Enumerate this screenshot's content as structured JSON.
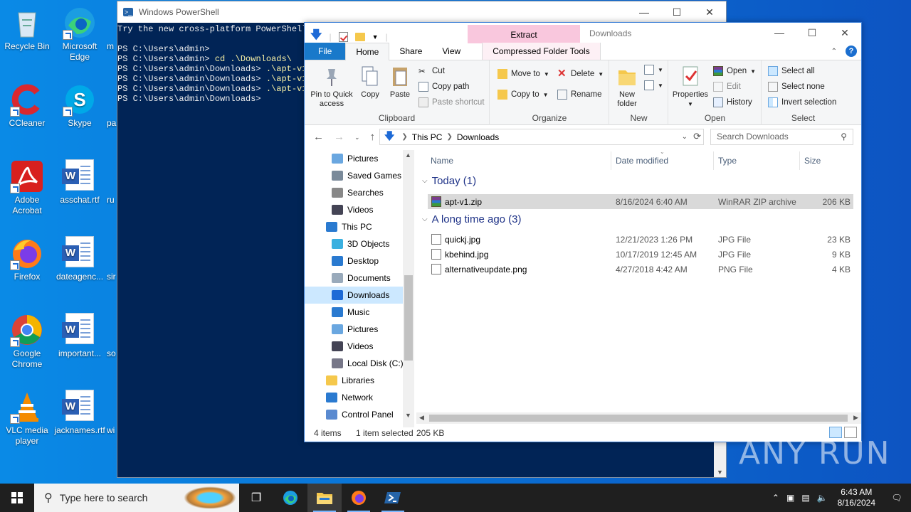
{
  "desktop_icons": [
    {
      "label": "Recycle Bin"
    },
    {
      "label": "Microsoft Edge"
    },
    {
      "label": "CCleaner"
    },
    {
      "label": "Skype"
    },
    {
      "label": "Adobe Acrobat"
    },
    {
      "label": "asschat.rtf"
    },
    {
      "label": "Firefox"
    },
    {
      "label": "dateagenc..."
    },
    {
      "label": "Google Chrome"
    },
    {
      "label": "important..."
    },
    {
      "label": "VLC media player"
    },
    {
      "label": "jacknames.rtf"
    }
  ],
  "desktop_partial": {
    "a": "m",
    "b": "pa",
    "c": "ru",
    "d": "sir",
    "e": "so",
    "f": "wi"
  },
  "powershell": {
    "title": "Windows PowerShell",
    "lines": [
      "Try the new cross-platform PowerShell",
      "",
      "PS C:\\Users\\admin>",
      "PS C:\\Users\\admin> cd .\\Downloads\\",
      "PS C:\\Users\\admin\\Downloads> .\\apt-v1.",
      "PS C:\\Users\\admin\\Downloads> .\\apt-v1.",
      "PS C:\\Users\\admin\\Downloads> .\\apt-v1.",
      "PS C:\\Users\\admin\\Downloads>"
    ],
    "l3_prompt": "PS C:\\Users\\admin> ",
    "l3_cmd": "cd .\\Downloads\\",
    "l_prompt": "PS C:\\Users\\admin\\Downloads> ",
    "l_cmd": ".\\apt-v1."
  },
  "explorer": {
    "title": "Downloads",
    "context_tab": "Extract",
    "tabs": {
      "file": "File",
      "home": "Home",
      "share": "Share",
      "view": "View",
      "cft": "Compressed Folder Tools"
    },
    "ribbon": {
      "clipboard": {
        "label": "Clipboard",
        "pin": "Pin to Quick access",
        "copy": "Copy",
        "paste": "Paste",
        "cut": "Cut",
        "copy_path": "Copy path",
        "paste_shortcut": "Paste shortcut"
      },
      "organize": {
        "label": "Organize",
        "move_to": "Move to",
        "copy_to": "Copy to",
        "delete": "Delete",
        "rename": "Rename"
      },
      "new": {
        "label": "New",
        "new_folder": "New folder"
      },
      "open": {
        "label": "Open",
        "properties": "Properties",
        "open": "Open",
        "edit": "Edit",
        "history": "History"
      },
      "select": {
        "label": "Select",
        "select_all": "Select all",
        "select_none": "Select none",
        "invert": "Invert selection"
      }
    },
    "breadcrumb": [
      "This PC",
      "Downloads"
    ],
    "search_placeholder": "Search Downloads",
    "nav_items": [
      {
        "label": "Pictures",
        "indent": 2
      },
      {
        "label": "Saved Games",
        "indent": 2
      },
      {
        "label": "Searches",
        "indent": 2
      },
      {
        "label": "Videos",
        "indent": 2
      },
      {
        "label": "This PC",
        "indent": 1
      },
      {
        "label": "3D Objects",
        "indent": 2
      },
      {
        "label": "Desktop",
        "indent": 2
      },
      {
        "label": "Documents",
        "indent": 2
      },
      {
        "label": "Downloads",
        "indent": 2,
        "selected": true
      },
      {
        "label": "Music",
        "indent": 2
      },
      {
        "label": "Pictures",
        "indent": 2
      },
      {
        "label": "Videos",
        "indent": 2
      },
      {
        "label": "Local Disk (C:)",
        "indent": 2
      },
      {
        "label": "Libraries",
        "indent": 1
      },
      {
        "label": "Network",
        "indent": 1
      },
      {
        "label": "Control Panel",
        "indent": 1
      }
    ],
    "columns": {
      "name": "Name",
      "date": "Date modified",
      "type": "Type",
      "size": "Size"
    },
    "groups": [
      {
        "header": "Today (1)",
        "files": [
          {
            "name": "apt-v1.zip",
            "date": "8/16/2024 6:40 AM",
            "type": "WinRAR ZIP archive",
            "size": "206 KB",
            "selected": true,
            "icon": "zip-icon"
          }
        ]
      },
      {
        "header": "A long time ago (3)",
        "files": [
          {
            "name": "quickj.jpg",
            "date": "12/21/2023 1:26 PM",
            "type": "JPG File",
            "size": "23 KB",
            "icon": "jpg-icon"
          },
          {
            "name": "kbehind.jpg",
            "date": "10/17/2019 12:45 AM",
            "type": "JPG File",
            "size": "9 KB",
            "icon": "jpg-icon"
          },
          {
            "name": "alternativeupdate.png",
            "date": "4/27/2018 4:42 AM",
            "type": "PNG File",
            "size": "4 KB",
            "icon": "png-icon"
          }
        ]
      }
    ],
    "status": {
      "items": "4 items",
      "selected": "1 item selected",
      "size": "205 KB"
    }
  },
  "taskbar": {
    "search_placeholder": "Type here to search",
    "time": "6:43 AM",
    "date": "8/16/2024"
  },
  "watermark": "ANY RUN",
  "colors": {
    "accent": "#1979ca",
    "desktop": "#0a6ad0",
    "ps_bg": "#012456"
  }
}
